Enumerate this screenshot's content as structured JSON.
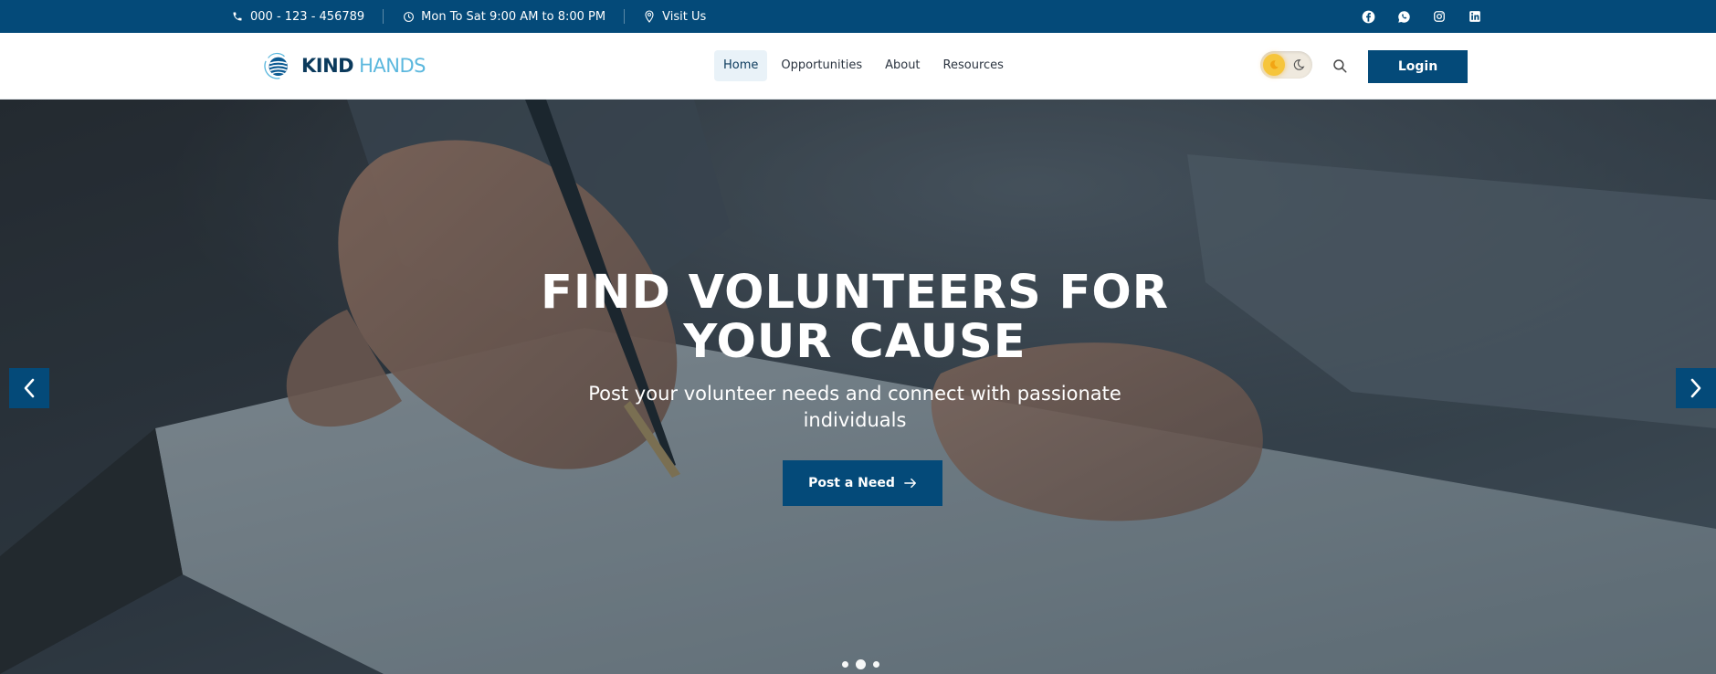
{
  "topbar": {
    "phone": "000 - 123 - 456789",
    "hours": "Mon To Sat 9:00 AM to 8:00 PM",
    "location": "Visit Us",
    "social": [
      "facebook-icon",
      "whatsapp-icon",
      "instagram-icon",
      "linkedin-icon"
    ]
  },
  "header": {
    "logo_word1": "KIND",
    "logo_word2": "HANDS",
    "nav": [
      {
        "label": "Home",
        "active": true
      },
      {
        "label": "Opportunities",
        "active": false
      },
      {
        "label": "About",
        "active": false
      },
      {
        "label": "Resources",
        "active": false
      }
    ],
    "login_label": "Login"
  },
  "hero": {
    "title_line1": "FIND VOLUNTEERS FOR",
    "title_line2": "YOUR CAUSE",
    "subtitle_line1": "Post your volunteer needs and connect with passionate",
    "subtitle_line2": "individuals",
    "cta_label": "Post a Need",
    "slide_count": 3,
    "active_slide": 2
  },
  "colors": {
    "brand_primary": "#044a79",
    "brand_dark": "#0b3a5c",
    "brand_accent": "#5cb8de",
    "toggle_sun": "#f6c53b"
  }
}
